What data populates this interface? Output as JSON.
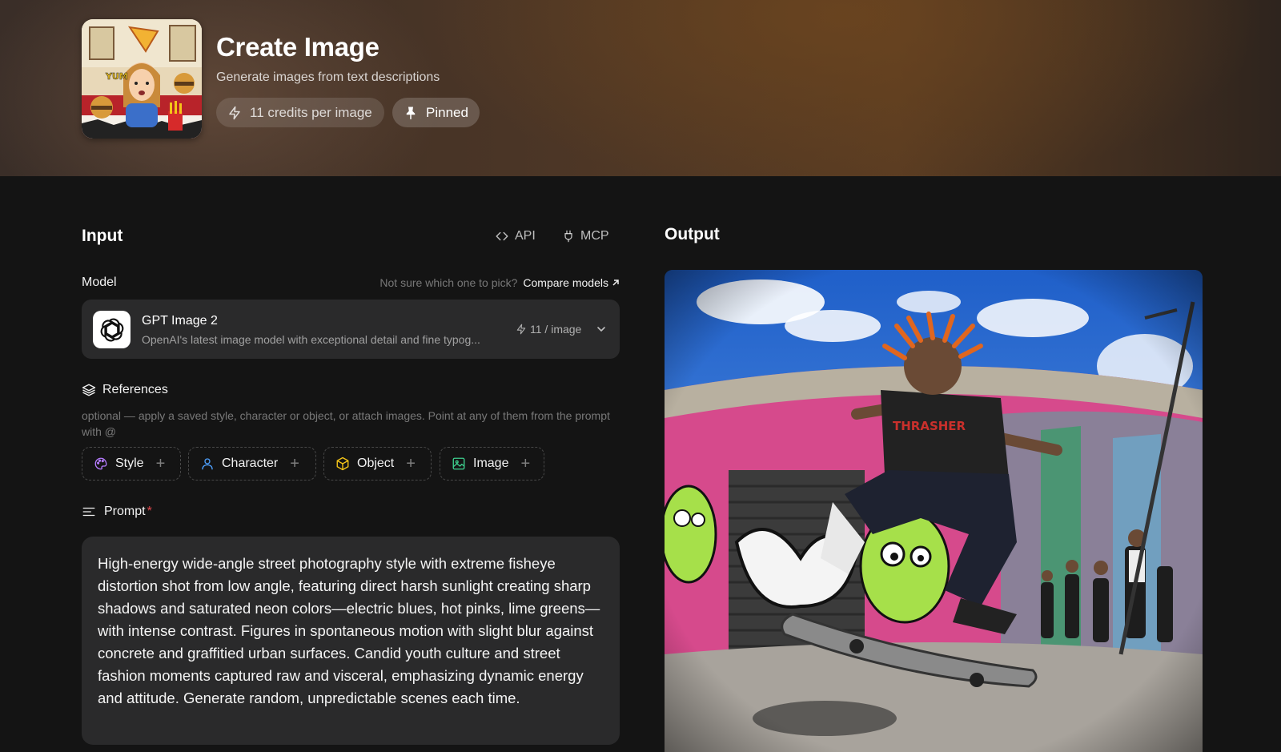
{
  "header": {
    "title": "Create Image",
    "subtitle": "Generate images from text descriptions",
    "credits_chip": "11 credits per image",
    "pinned_chip": "Pinned"
  },
  "input": {
    "title": "Input",
    "api_label": "API",
    "mcp_label": "MCP",
    "model_label": "Model",
    "model_hint": "Not sure which one to pick?",
    "compare_link": "Compare models",
    "model": {
      "name": "GPT Image 2",
      "description": "OpenAI's latest image model with exceptional detail and fine typog...",
      "cost": "11 / image"
    },
    "references": {
      "label": "References",
      "description": "optional — apply a saved style, character or object, or attach images. Point at any of them from the prompt with @",
      "buttons": [
        "Style",
        "Character",
        "Object",
        "Image"
      ]
    },
    "prompt": {
      "label": "Prompt",
      "required_mark": "*",
      "value": "High-energy wide-angle street photography style with extreme fisheye distortion shot from low angle, featuring direct harsh sunlight creating sharp shadows and saturated neon colors—electric blues, hot pinks, lime greens—with intense contrast. Figures in spontaneous motion with slight blur against concrete and graffitied urban surfaces. Candid youth culture and street fashion moments captured raw and visceral, emphasizing dynamic energy and attitude. Generate random, unpredictable scenes each time."
    }
  },
  "output": {
    "title": "Output"
  },
  "colors": {
    "background": "#141414",
    "card": "#2a2a2b",
    "style_icon": "#b57bff",
    "character_icon": "#4ea1ff",
    "object_icon": "#f5c518",
    "image_icon": "#3ecf8e",
    "required": "#e5484d"
  },
  "icons": {
    "credits": "lightning-icon",
    "pinned": "pin-icon",
    "api": "code-icon",
    "mcp": "plug-icon",
    "model_logo": "openai-logo-icon",
    "references": "layers-icon",
    "prompt": "text-lines-icon"
  }
}
